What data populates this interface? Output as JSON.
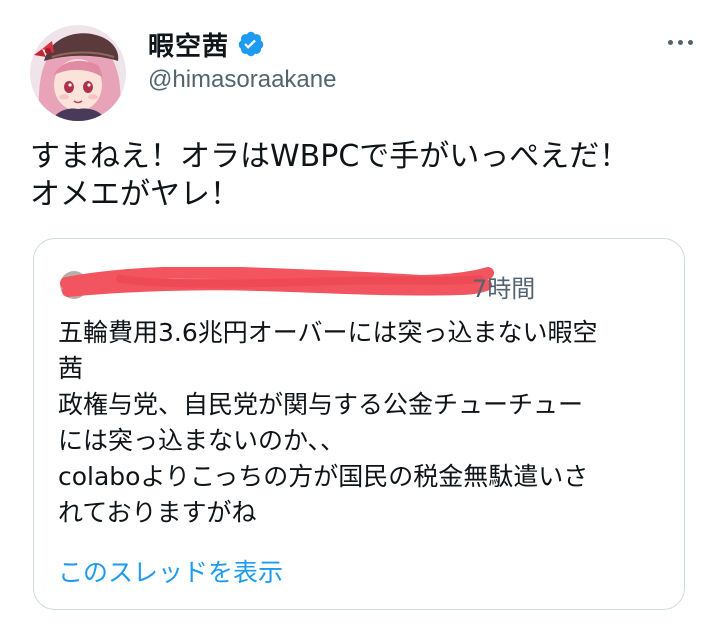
{
  "tweet": {
    "author": {
      "display_name": "暇空茜",
      "handle": "@himasoraakane",
      "verified": true
    },
    "more_icon": "more-horizontal-icon",
    "text_lines": [
      "すまねえ！オラはWBPCで手がいっぺえだ！",
      "オメエがヤレ！"
    ],
    "quote": {
      "time": "7時間",
      "body_lines": [
        "五輪費用3.6兆円オーバーには突っ込まない暇空",
        "茜",
        "政権与党、自民党が関与する公金チューチュー",
        "には突っ込まないのか、、",
        "colaboよりこっちの方が国民の税金無駄遣いさ",
        "れておりますがね"
      ],
      "show_thread_label": "このスレッドを表示"
    }
  },
  "colors": {
    "link": "#1d9bf0",
    "secondary_text": "#536471",
    "border": "#cfd9de",
    "redaction": "#f2555f",
    "verified": "#1d9bf0"
  }
}
